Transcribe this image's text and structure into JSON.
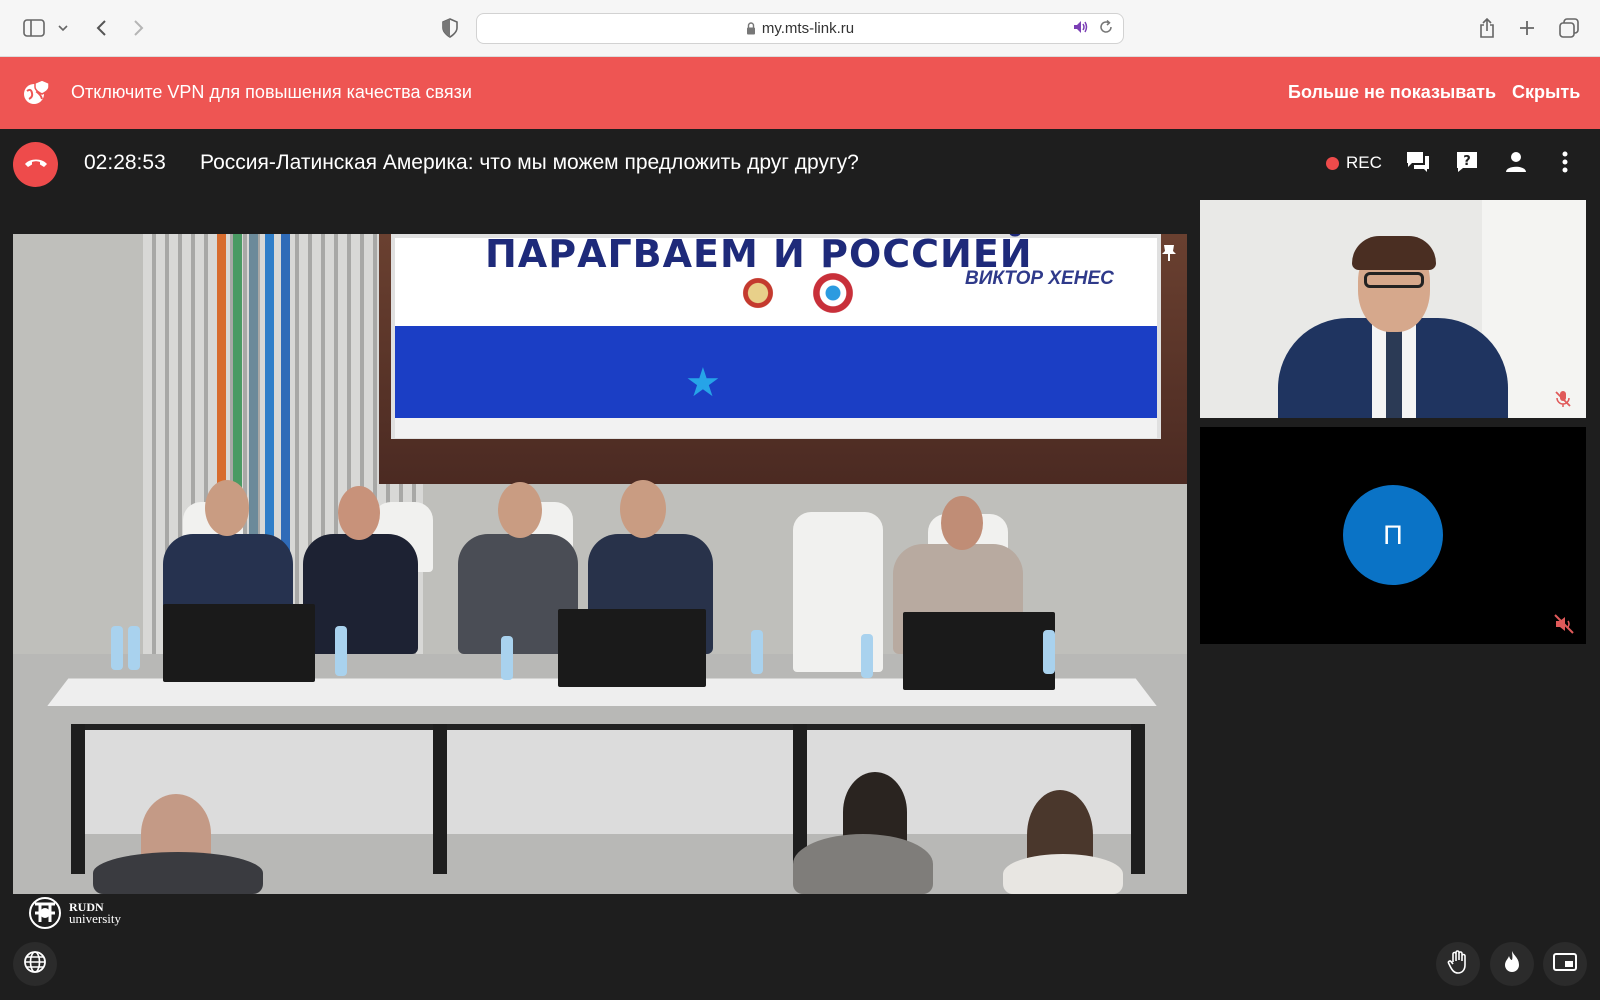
{
  "browser": {
    "url": "my.mts-link.ru",
    "sidebar_icon": "sidebar-icon",
    "back_icon": "chevron-left-icon",
    "forward_icon": "chevron-right-icon",
    "privacy_icon": "shield-icon",
    "share_icon": "share-icon",
    "new_tab_icon": "plus-icon",
    "tabs_icon": "tabs-icon"
  },
  "banner": {
    "text": "Отключите VPN для повышения качества связи",
    "dont_show_label": "Больше не показывать",
    "hide_label": "Скрыть",
    "color": "#ee5553"
  },
  "header": {
    "timer": "02:28:53",
    "title": "Россия-Латинская Америка: что мы можем предложить друг другу?",
    "rec_label": "REC"
  },
  "main_video": {
    "slide_heading": "ПАРАГВАЕМ И РОССИЕЙ",
    "slide_speaker": "ВИКТОР ХЕНЕС"
  },
  "participants": [
    {
      "tile": "camera",
      "muted": true
    },
    {
      "tile": "avatar",
      "initial": "П",
      "avatar_color": "#0a73c6",
      "sound_muted": true
    }
  ],
  "footer": {
    "logo_line1": "RUDN",
    "logo_line2": "university"
  },
  "colors": {
    "hangup": "#ee4b4b",
    "background": "#1e1e1e"
  }
}
